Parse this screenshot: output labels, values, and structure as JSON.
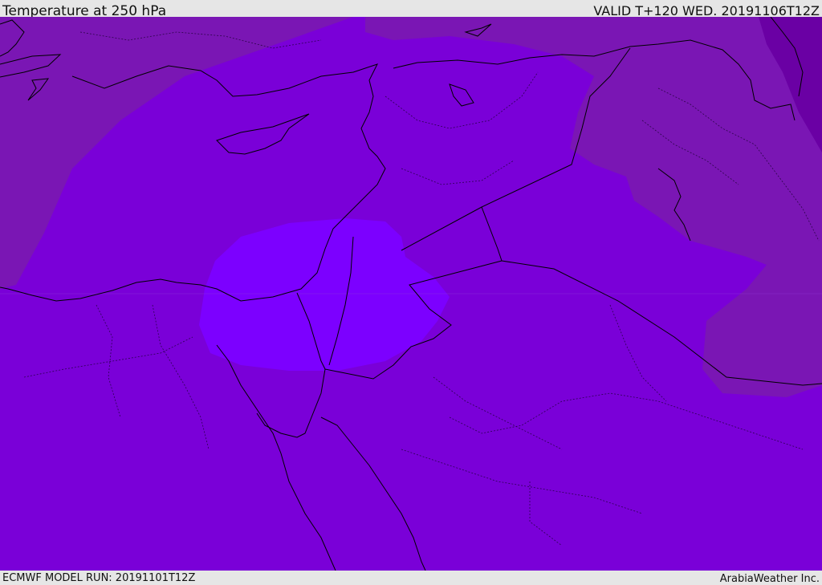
{
  "header": {
    "title": "Temperature at 250 hPa",
    "valid": "VALID T+120 WED. 20191106T12Z"
  },
  "footer": {
    "model_run": "ECMWF MODEL RUN: 20191101T12Z",
    "credit": "ArabiaWeather Inc."
  },
  "colors": {
    "background": "#e6e6e6",
    "temp_warm_band": "#7a16b4",
    "temp_mid_band": "#7a00d8",
    "temp_cold_band": "#7c00ff",
    "temp_warmest_band": "#6a00a4",
    "coastline": "#000000",
    "border": "#000000"
  }
}
